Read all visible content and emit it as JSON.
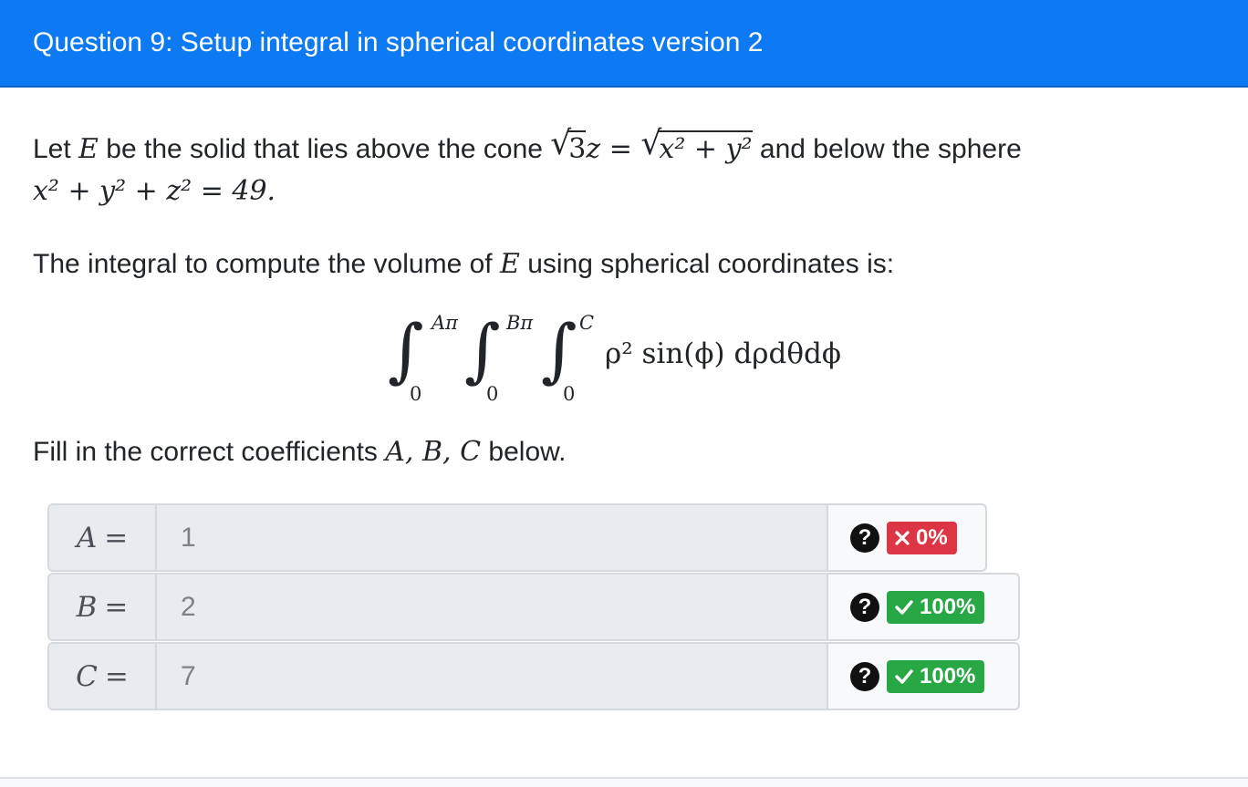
{
  "header": {
    "title": "Question 9: Setup integral in spherical coordinates version 2"
  },
  "question": {
    "p1_a": "Let ",
    "p1_E": "E",
    "p1_b": " be the solid that lies above the cone ",
    "cone_lhs_root": "3",
    "cone_lhs_var": "z",
    "cone_eq": " = ",
    "cone_rhs": "x² + y²",
    "p1_c": " and below the sphere",
    "sphere_eq": "x² + y² + z² = 49.",
    "p2_a": "The integral to compute the volume of ",
    "p2_E": "E",
    "p2_b": " using spherical coordinates is:",
    "p3_a": "Fill in the correct coefficients ",
    "p3_vars": "A, B, C",
    "p3_b": " below."
  },
  "integral": {
    "upper1": "Aπ",
    "upper2": "Bπ",
    "upper3": "C",
    "lower1": "0",
    "lower2": "0",
    "lower3": "0",
    "integrand": "ρ² sin(ϕ) dρdθdϕ"
  },
  "answers": [
    {
      "label": "A",
      "eq": "=",
      "value": "1",
      "badge": "0%",
      "status": "incorrect"
    },
    {
      "label": "B",
      "eq": "=",
      "value": "2",
      "badge": "100%",
      "status": "correct"
    },
    {
      "label": "C",
      "eq": "=",
      "value": "7",
      "badge": "100%",
      "status": "correct"
    }
  ],
  "icons": {
    "help": "question-circle-icon",
    "incorrect": "x-icon",
    "correct": "check-icon"
  },
  "colors": {
    "header": "#0d79f2",
    "incorrect": "#dc3545",
    "correct": "#28a745"
  },
  "help_glyph": "?"
}
